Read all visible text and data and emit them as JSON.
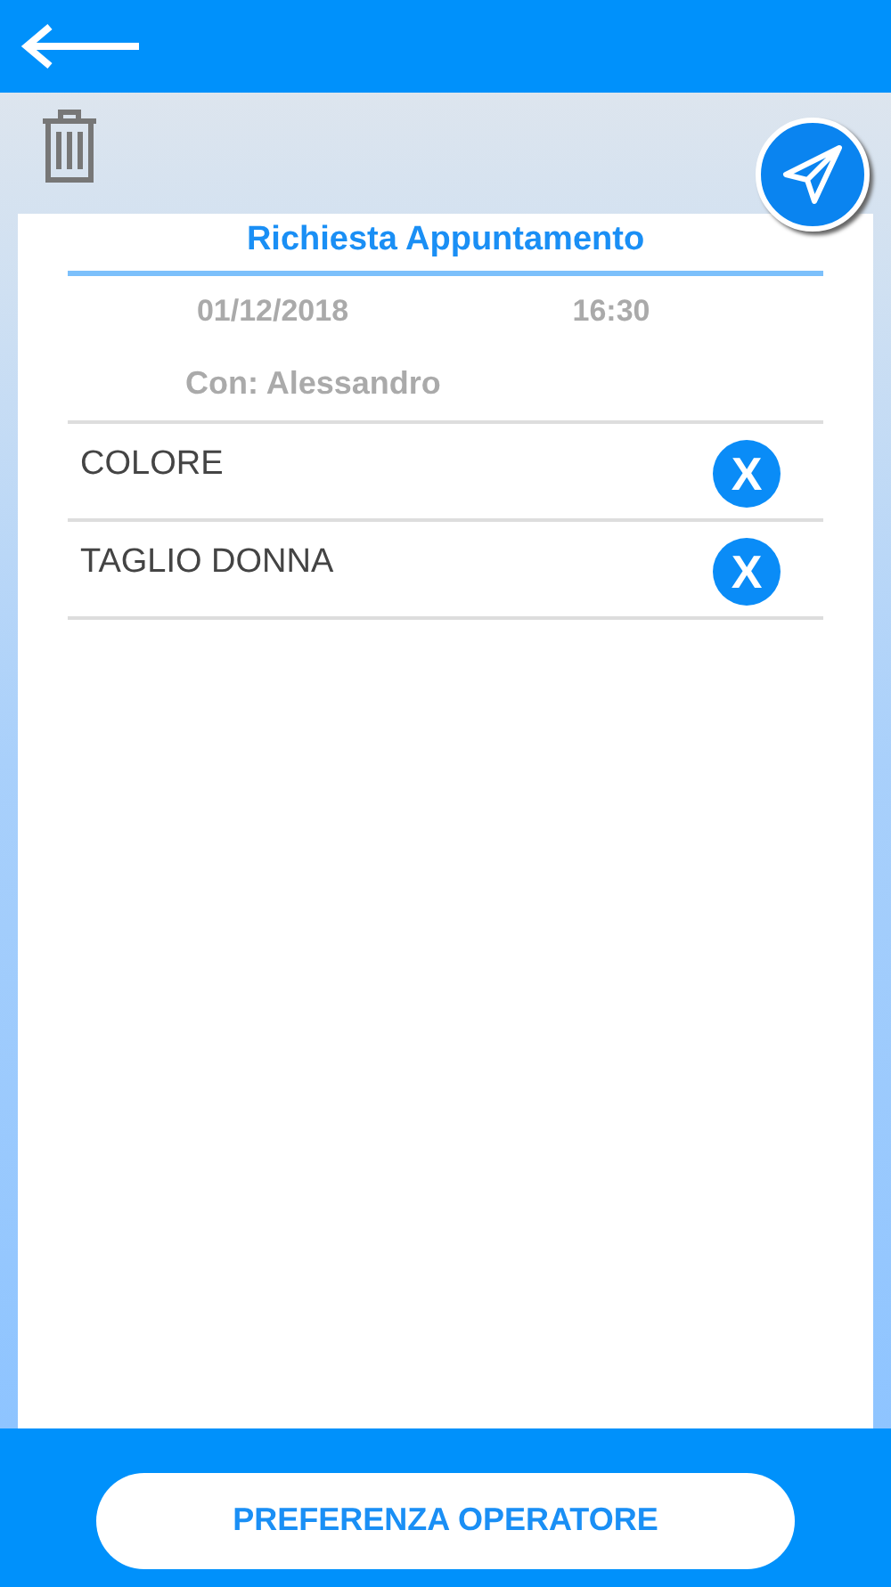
{
  "title": "Richiesta Appuntamento",
  "date": "01/12/2018",
  "time": "16:30",
  "operator": "Con: Alessandro",
  "services": [
    {
      "name": "COLORE",
      "remove": "X"
    },
    {
      "name": "TAGLIO DONNA",
      "remove": "X"
    }
  ],
  "footer_button": "PREFERENZA OPERATORE"
}
